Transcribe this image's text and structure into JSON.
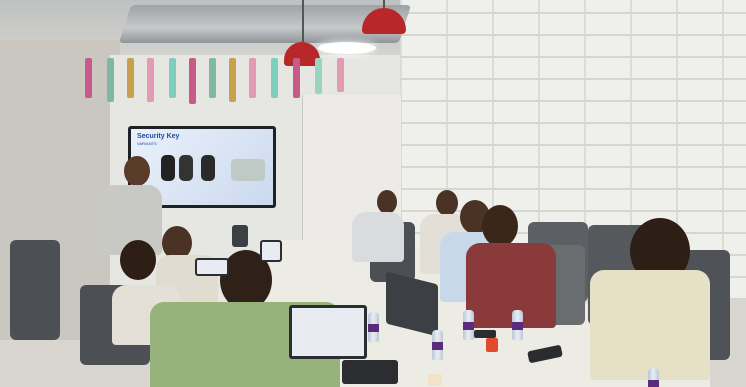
{
  "scene": {
    "kind": "photo",
    "subject": "meeting-room-presentation"
  },
  "slide": {
    "title": "Security Key",
    "subtitle": "VARIANTS"
  },
  "colors": {
    "brick_wall": "#efefeb",
    "lamp_red": "#b8282b",
    "table": "#ecebe4",
    "chair": "#4c4f53"
  }
}
